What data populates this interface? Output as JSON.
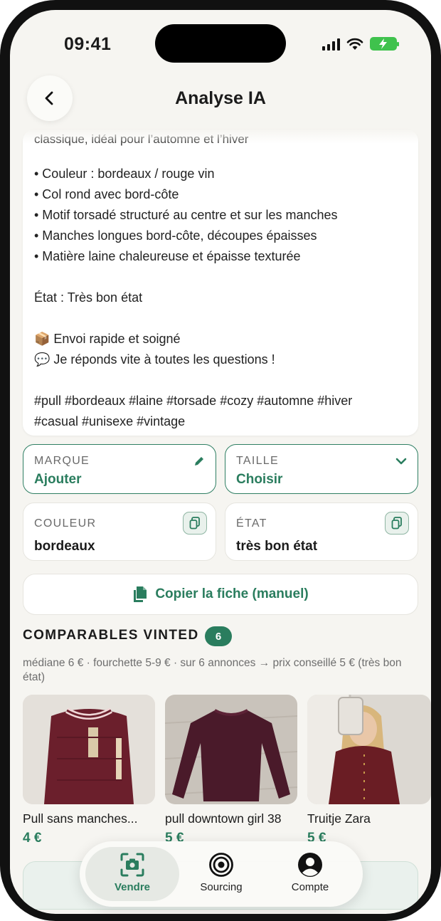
{
  "status": {
    "time": "09:41"
  },
  "header": {
    "title": "Analyse IA",
    "back_icon": "chevron-left-icon"
  },
  "description": {
    "cut_line": "classique, idéal pour l’automne et l’hiver",
    "bullets": [
      "• Couleur : bordeaux / rouge vin",
      "• Col rond avec bord-côte",
      "• Motif torsadé structuré au centre et sur les manches",
      "• Manches longues bord-côte, découpes épaisses",
      "• Matière laine chaleureuse et épaisse texturée"
    ],
    "state_line": "État : Très bon état",
    "shipping_line": "📦 Envoi rapide et soigné",
    "reply_line": "💬 Je réponds vite à toutes les questions !",
    "hashtags_1": "#pull #bordeaux #laine #torsade #cozy #automne #hiver",
    "hashtags_2": "#casual #unisexe #vintage"
  },
  "attributes": {
    "brand": {
      "label": "MARQUE",
      "value": "Ajouter",
      "icon": "pencil-icon"
    },
    "size": {
      "label": "TAILLE",
      "value": "Choisir",
      "icon": "chevron-down-icon"
    },
    "color": {
      "label": "COULEUR",
      "value": "bordeaux",
      "icon": "copy-icon"
    },
    "condition": {
      "label": "ÉTAT",
      "value": "très bon état",
      "icon": "copy-icon"
    }
  },
  "copy_button": {
    "label": "Copier la fiche (manuel)"
  },
  "comparables": {
    "title": "COMPARABLES VINTED",
    "count": "6",
    "summary": "médiane 6 € · fourchette 5-9 € · sur 6 annonces → prix conseillé 5 € (très bon état)",
    "items": [
      {
        "title": "Pull sans manches...",
        "price": "4 €"
      },
      {
        "title": "pull downtown girl 38",
        "price": "5 €"
      },
      {
        "title": "Truitje Zara",
        "price": "5 €"
      }
    ]
  },
  "tabbar": {
    "tabs": [
      {
        "label": "Vendre",
        "icon": "camera-icon"
      },
      {
        "label": "Sourcing",
        "icon": "target-icon"
      },
      {
        "label": "Compte",
        "icon": "user-icon"
      }
    ]
  },
  "colors": {
    "accent": "#2a7d5e",
    "background": "#f6f5f1",
    "battery": "#3fc24d"
  }
}
